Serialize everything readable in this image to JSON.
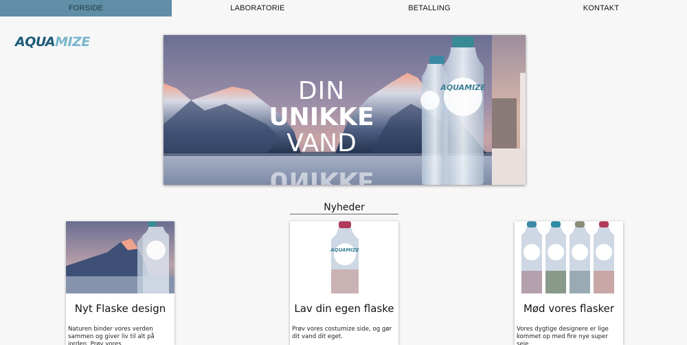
{
  "nav": {
    "items": [
      {
        "label": "FORSIDE",
        "active": true
      },
      {
        "label": "LABORATORIE",
        "active": false
      },
      {
        "label": "BETALLING",
        "active": false
      },
      {
        "label": "KONTAKT",
        "active": false
      }
    ],
    "active_color": "#5f8ea6"
  },
  "logo": {
    "part1": "AQUA",
    "part2": "MIZE"
  },
  "hero": {
    "line1": "DIN",
    "line2": "UNIKKE",
    "line3": "VAND",
    "bottle_label": "AQUAMIZE"
  },
  "news": {
    "heading": "Nyheder",
    "cards": [
      {
        "title": "Nyt Flaske design",
        "text": "Naturen binder vores verden sammen og giver liv til alt på jorden. Prøv vores"
      },
      {
        "title": "Lav din egen flaske",
        "text": "Prøv vores costumize side, og gør dit vand dit eget."
      },
      {
        "title": "Mød vores flasker",
        "text": "Vores dygtige designere er lige kommet op med fire nye super seje"
      }
    ],
    "bottle_label": "AQUAMIZE"
  }
}
